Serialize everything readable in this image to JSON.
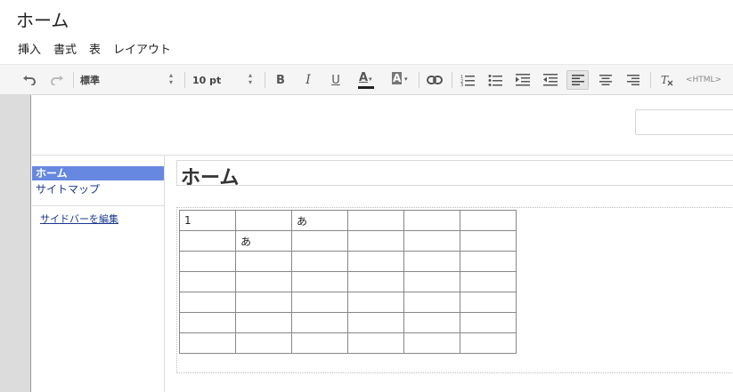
{
  "app": {
    "title": "ホーム"
  },
  "menu": {
    "items": [
      "挿入",
      "書式",
      "表",
      "レイアウト"
    ]
  },
  "toolbar": {
    "style_value": "標準",
    "font_size_value": "10 pt",
    "bold": "B",
    "italic": "I",
    "underline": "U",
    "text_color": "A",
    "highlight": "A",
    "html_button": "<HTML>",
    "active_alignment": "align-left",
    "icons": [
      "undo-icon",
      "redo-icon",
      "link-icon",
      "numbered-list-icon",
      "bulleted-list-icon",
      "indent-icon",
      "outdent-icon",
      "align-left-icon",
      "align-center-icon",
      "align-right-icon",
      "clear-formatting-icon"
    ]
  },
  "sidebar": {
    "items": [
      {
        "label": "ホーム",
        "selected": true
      },
      {
        "label": "サイトマップ",
        "selected": false
      }
    ],
    "edit_link": "サイドバーを編集"
  },
  "page": {
    "title": "ホーム",
    "table": {
      "rows": [
        [
          "1",
          "",
          "あ",
          "",
          "",
          ""
        ],
        [
          "",
          "あ",
          "",
          "",
          "",
          ""
        ],
        [
          "",
          "",
          "",
          "",
          "",
          ""
        ],
        [
          "",
          "",
          "",
          "",
          "",
          ""
        ],
        [
          "",
          "",
          "",
          "",
          "",
          ""
        ],
        [
          "",
          "",
          "",
          "",
          "",
          ""
        ],
        [
          "",
          "",
          "",
          "",
          "",
          ""
        ]
      ]
    }
  },
  "colors": {
    "selection": "#6688e0",
    "link": "#1a3a8f",
    "toolbar_bg": "#f5f5f5"
  }
}
